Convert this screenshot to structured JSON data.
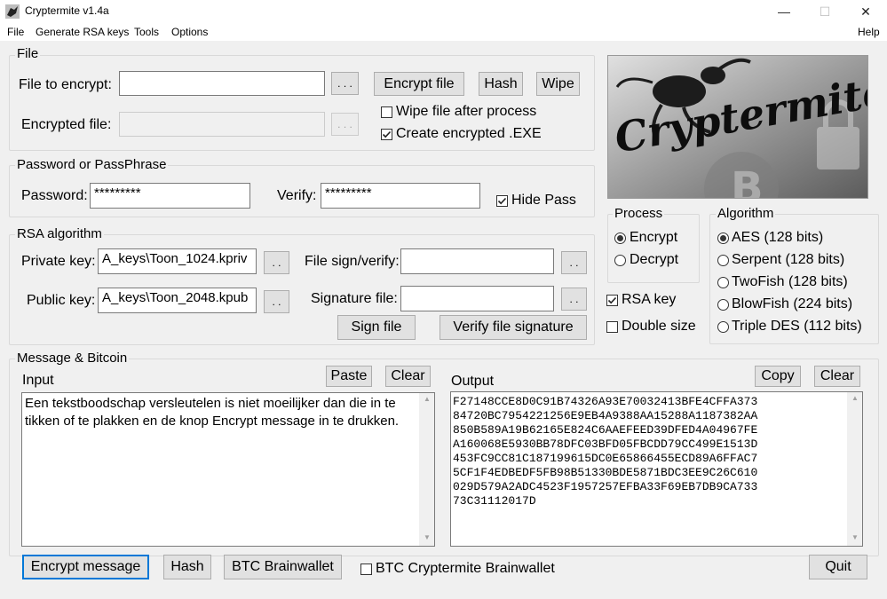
{
  "window": {
    "title": "Cryptermite v1.4a",
    "minimize_glyph": "—",
    "maximize_glyph": "☐",
    "close_glyph": "✕"
  },
  "menu": {
    "file": "File",
    "generate_rsa": "Generate RSA keys",
    "tools": "Tools",
    "options": "Options",
    "help": "Help"
  },
  "file_group": {
    "title": "File",
    "file_to_encrypt_label": "File to encrypt:",
    "file_to_encrypt_value": "",
    "browse_label": ". . .",
    "encrypted_file_label": "Encrypted file:",
    "encrypted_file_value": "",
    "encrypt_file_button": "Encrypt file",
    "hash_button": "Hash",
    "wipe_button": "Wipe",
    "wipe_after_label": "Wipe file after process",
    "wipe_after_checked": false,
    "create_exe_label": "Create encrypted .EXE",
    "create_exe_checked": true
  },
  "password_group": {
    "title": "Password or PassPhrase",
    "password_label": "Password:",
    "password_value": "*********",
    "verify_label": "Verify:",
    "verify_value": "*********",
    "hide_pass_label": "Hide Pass",
    "hide_pass_checked": true
  },
  "rsa_group": {
    "title": "RSA algorithm",
    "private_key_label": "Private key:",
    "private_key_value": "A_keys\\Toon_1024.kpriv",
    "public_key_label": "Public key:",
    "public_key_value": "A_keys\\Toon_2048.kpub",
    "small_browse": ". .",
    "file_sign_label": "File sign/verify:",
    "file_sign_value": "",
    "signature_file_label": "Signature file:",
    "signature_file_value": "",
    "sign_file_button": "Sign file",
    "verify_signature_button": "Verify file signature"
  },
  "logo": {
    "text": "Cryptermite"
  },
  "process_group": {
    "title": "Process",
    "options": [
      "Encrypt",
      "Decrypt"
    ],
    "selected": "Encrypt"
  },
  "rsa_key_label": "RSA key",
  "rsa_key_checked": true,
  "double_size_label": "Double size",
  "double_size_checked": false,
  "algorithm_group": {
    "title": "Algorithm",
    "options": [
      "AES (128 bits)",
      "Serpent (128 bits)",
      "TwoFish (128 bits)",
      "BlowFish (224 bits)",
      "Triple DES (112 bits)"
    ],
    "selected": "AES (128 bits)"
  },
  "message_group": {
    "title": "Message & Bitcoin",
    "input_label": "Input",
    "paste_button": "Paste",
    "clear_button": "Clear",
    "input_text": "Een tekstboodschap versleutelen is niet moeilijker dan die in te tikken of te plakken en de knop Encrypt message in te drukken.",
    "output_label": "Output",
    "copy_button": "Copy",
    "clear_output_button": "Clear",
    "output_lines": [
      "F27148CCE8D0C91B74326A93E70032413BFE4CFFA373",
      "84720BC7954221256E9EB4A9388AA15288A1187382AA",
      "850B589A19B62165E824C6AAEFEED39DFED4A04967FE",
      "A160068E5930BB78DFC03BFD05FBCDD79CC499E1513D",
      "453FC9CC81C187199615DC0E65866455ECD89A6FFAC7",
      "5CF1F4EDBEDF5FB98B51330BDE5871BDC3EE9C26C610",
      "029D579A2ADC4523F1957257EFBA33F69EB7DB9CA733",
      "73C31112017D"
    ]
  },
  "bottom": {
    "encrypt_message_button": "Encrypt message",
    "hash_button": "Hash",
    "btc_brainwallet_button": "BTC Brainwallet",
    "btc_cryptermite_label": "BTC Cryptermite Brainwallet",
    "btc_cryptermite_checked": false,
    "quit_button": "Quit"
  },
  "scroll": {
    "up_glyph": "▲",
    "down_glyph": "▼"
  },
  "colors": {
    "window_bg": "#f0f0f0",
    "focus_blue": "#0078d7"
  }
}
